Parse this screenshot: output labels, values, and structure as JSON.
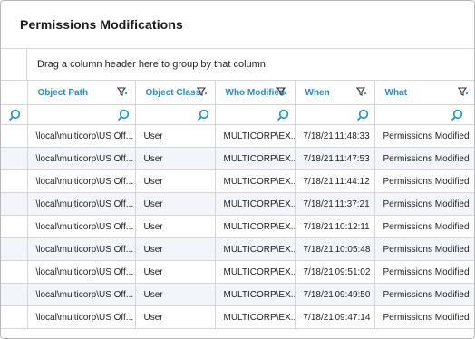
{
  "title": "Permissions Modifications",
  "group_panel_text": "Drag a column header here to group by that column",
  "columns": [
    {
      "label": "Object Path"
    },
    {
      "label": "Object Class"
    },
    {
      "label": "Who Modified"
    },
    {
      "label": "When"
    },
    {
      "label": "What"
    }
  ],
  "rows": [
    {
      "path": "\\local\\multicorp\\US Off...",
      "cls": "User",
      "who": "MULTICORP\\EX...",
      "date": "7/18/21",
      "time": "11:48:33",
      "what": "Permissions Modified"
    },
    {
      "path": "\\local\\multicorp\\US Off...",
      "cls": "User",
      "who": "MULTICORP\\EX...",
      "date": "7/18/21",
      "time": "11:47:53",
      "what": "Permissions Modified"
    },
    {
      "path": "\\local\\multicorp\\US Off...",
      "cls": "User",
      "who": "MULTICORP\\EX...",
      "date": "7/18/21",
      "time": "11:44:12",
      "what": "Permissions Modified"
    },
    {
      "path": "\\local\\multicorp\\US Off...",
      "cls": "User",
      "who": "MULTICORP\\EX...",
      "date": "7/18/21",
      "time": "11:37:21",
      "what": "Permissions Modified"
    },
    {
      "path": "\\local\\multicorp\\US Off...",
      "cls": "User",
      "who": "MULTICORP\\EX...",
      "date": "7/18/21",
      "time": "10:12:11",
      "what": "Permissions Modified"
    },
    {
      "path": "\\local\\multicorp\\US Off...",
      "cls": "User",
      "who": "MULTICORP\\EX...",
      "date": "7/18/21",
      "time": "10:05:48",
      "what": "Permissions Modified"
    },
    {
      "path": "\\local\\multicorp\\US Off...",
      "cls": "User",
      "who": "MULTICORP\\EX...",
      "date": "7/18/21",
      "time": "09:51:02",
      "what": "Permissions Modified"
    },
    {
      "path": "\\local\\multicorp\\US Off...",
      "cls": "User",
      "who": "MULTICORP\\EX...",
      "date": "7/18/21",
      "time": "09:49:50",
      "what": "Permissions Modified"
    },
    {
      "path": "\\local\\multicorp\\US Off...",
      "cls": "User",
      "who": "MULTICORP\\EX...",
      "date": "7/18/21",
      "time": "09:47:14",
      "what": "Permissions Modified"
    }
  ],
  "colors": {
    "accent": "#1f8fd6",
    "grid_line": "#d6d6d6",
    "alt_row": "#f2f6fa"
  }
}
